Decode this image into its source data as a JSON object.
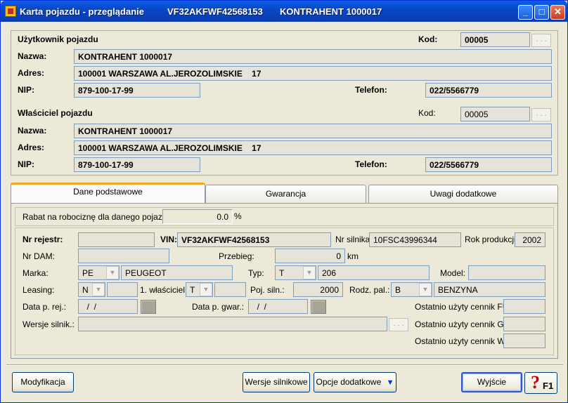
{
  "window": {
    "title": "Karta pojazdu - przeglądanie",
    "vin_title": "VF32AKFWF42568153",
    "contractor_title": "KONTRAHENT 1000017"
  },
  "user": {
    "section_label": "Użytkownik pojazdu",
    "kod_label": "Kod:",
    "kod_value": "00005",
    "name_label": "Nazwa:",
    "name_value": "KONTRAHENT 1000017",
    "address_label": "Adres:",
    "address_value": "100001 WARSZAWA AL.JEROZOLIMSKIE    17",
    "nip_label": "NIP:",
    "nip_value": "879-100-17-99",
    "phone_label": "Telefon:",
    "phone_value": "022/5566779"
  },
  "owner": {
    "section_label": "Właściciel pojazdu",
    "kod_label": "Kod:",
    "kod_value": "00005",
    "name_label": "Nazwa:",
    "name_value": "KONTRAHENT 1000017",
    "address_label": "Adres:",
    "address_value": "100001 WARSZAWA AL.JEROZOLIMSKIE    17",
    "nip_label": "NIP:",
    "nip_value": "879-100-17-99",
    "phone_label": "Telefon:",
    "phone_value": "022/5566779"
  },
  "dots": ". . .",
  "tabs": [
    "Dane podstawowe",
    "Gwarancja",
    "Uwagi dodatkowe"
  ],
  "basic": {
    "rabat_label": "Rabat na robociznę dla danego pojazdu:",
    "rabat_value": "0.0",
    "rabat_unit": "%",
    "nr_rej_label": "Nr rejestr:",
    "nr_rej_value": "",
    "vin_label": "VIN:",
    "vin_value": "VF32AKFWF42568153",
    "nr_silnika_label": "Nr silnika:",
    "nr_silnika_value": "10FSC43996344",
    "rok_label": "Rok produkcji:",
    "rok_value": "2002",
    "nr_dam_label": "Nr DAM:",
    "nr_dam_value": "",
    "przebieg_label": "Przebieg:",
    "przebieg_value": "0",
    "przebieg_unit": "km",
    "marka_label": "Marka:",
    "marka_code": "PE",
    "marka_name": "PEUGEOT",
    "typ_label": "Typ:",
    "typ_code": "T",
    "typ_name": "206",
    "model_label": "Model:",
    "model_value": "",
    "leasing_label": "Leasing:",
    "leasing_value": "N",
    "leasing_extra": "",
    "first_owner_label": "1. właściciel:",
    "first_owner_value": "T",
    "first_owner_extra": "",
    "poj_label": "Poj. siln.:",
    "poj_value": "2000",
    "rodz_label": "Rodz. pal.:",
    "rodz_code": "B",
    "rodz_name": "BENZYNA",
    "data_rej_label": "Data p. rej.:",
    "data_rej_value": "  /  /",
    "data_gwar_label": "Data p. gwar.:",
    "data_gwar_value": "  /  /",
    "fu_label": "Ostatnio użyty cennik FU:",
    "fu_value": "",
    "gw_label": "Ostatnio użyty cennik GW:",
    "gw_value": "",
    "we_label": "Ostatnio użyty cennik WE:",
    "we_value": "",
    "wersje_label": "Wersje silnik.:",
    "wersje_value": ""
  },
  "buttons": {
    "modify": "Modyfikacja",
    "engine_versions": "Wersje silnikowe",
    "extra_options": "Opcje dodatkowe",
    "exit": "Wyjście",
    "help": "F1"
  },
  "colors": {
    "titlebar": "#0a47c6",
    "window_bg": "#ece9d8",
    "tab_accent": "#f5a623",
    "dropdown_arrow": "#0033cc",
    "help_icon": "#cc0000"
  }
}
